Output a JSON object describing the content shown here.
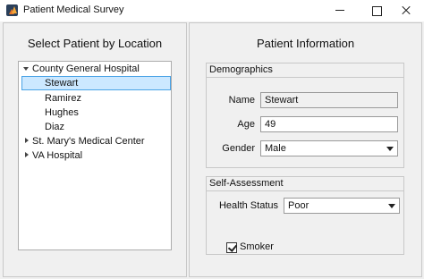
{
  "window": {
    "title": "Patient Medical Survey",
    "app_icon": "matlab-logo-icon",
    "controls": [
      "minimize-icon",
      "maximize-icon",
      "close-icon"
    ]
  },
  "left_panel": {
    "title": "Select Patient by Location",
    "tree": [
      {
        "label": "County General Hospital",
        "expanded": true,
        "children": [
          "Stewart",
          "Ramirez",
          "Hughes",
          "Diaz"
        ]
      },
      {
        "label": "St. Mary's Medical Center",
        "expanded": false
      },
      {
        "label": "VA Hospital",
        "expanded": false
      }
    ],
    "selected": "Stewart"
  },
  "right_panel": {
    "title": "Patient Information",
    "demographics": {
      "title": "Demographics",
      "name_label": "Name",
      "name_value": "Stewart",
      "age_label": "Age",
      "age_value": "49",
      "gender_label": "Gender",
      "gender_value": "Male"
    },
    "self_assessment": {
      "title": "Self-Assessment",
      "health_label": "Health Status",
      "health_value": "Poor",
      "smoker_label": "Smoker",
      "smoker_checked": true
    }
  },
  "colors": {
    "selection_fill": "#cce8ff",
    "selection_border": "#4aa3e6",
    "background": "#f0f0f0"
  }
}
